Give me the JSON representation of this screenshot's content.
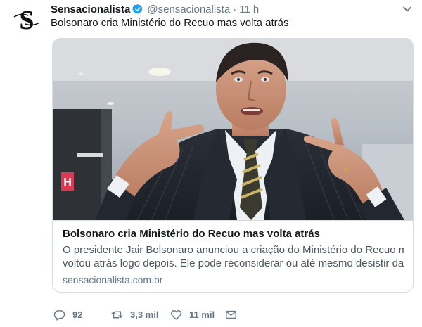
{
  "tweet": {
    "author": {
      "name": "Sensacionalista",
      "handle": "@sensacionalista",
      "verified": true,
      "avatar_letter": "S"
    },
    "separator": "·",
    "time": "11 h",
    "text": "Bolsonaro cria Ministério do Recuo mas volta atrás",
    "card": {
      "image_icon": "photo-man-in-suit-pointing",
      "image_sign": "H",
      "title": "Bolsonaro cria Ministério do Recuo mas volta atrás",
      "description_line1": "O presidente Jair Bolsonaro anunciou a criação do Ministério do Recuo mas",
      "description_line2": "voltou atrás logo depois. Ele pode reconsiderar ou até mesmo desistir da...",
      "domain": "sensacionalista.com.br"
    },
    "actions": {
      "reply_count": "92",
      "retweet_count": "3,3 mil",
      "like_count": "11 mil"
    }
  },
  "colors": {
    "verified_blue": "#1da1f2",
    "text_primary": "#14171a",
    "text_secondary": "#657786",
    "border": "#d6dde3"
  }
}
